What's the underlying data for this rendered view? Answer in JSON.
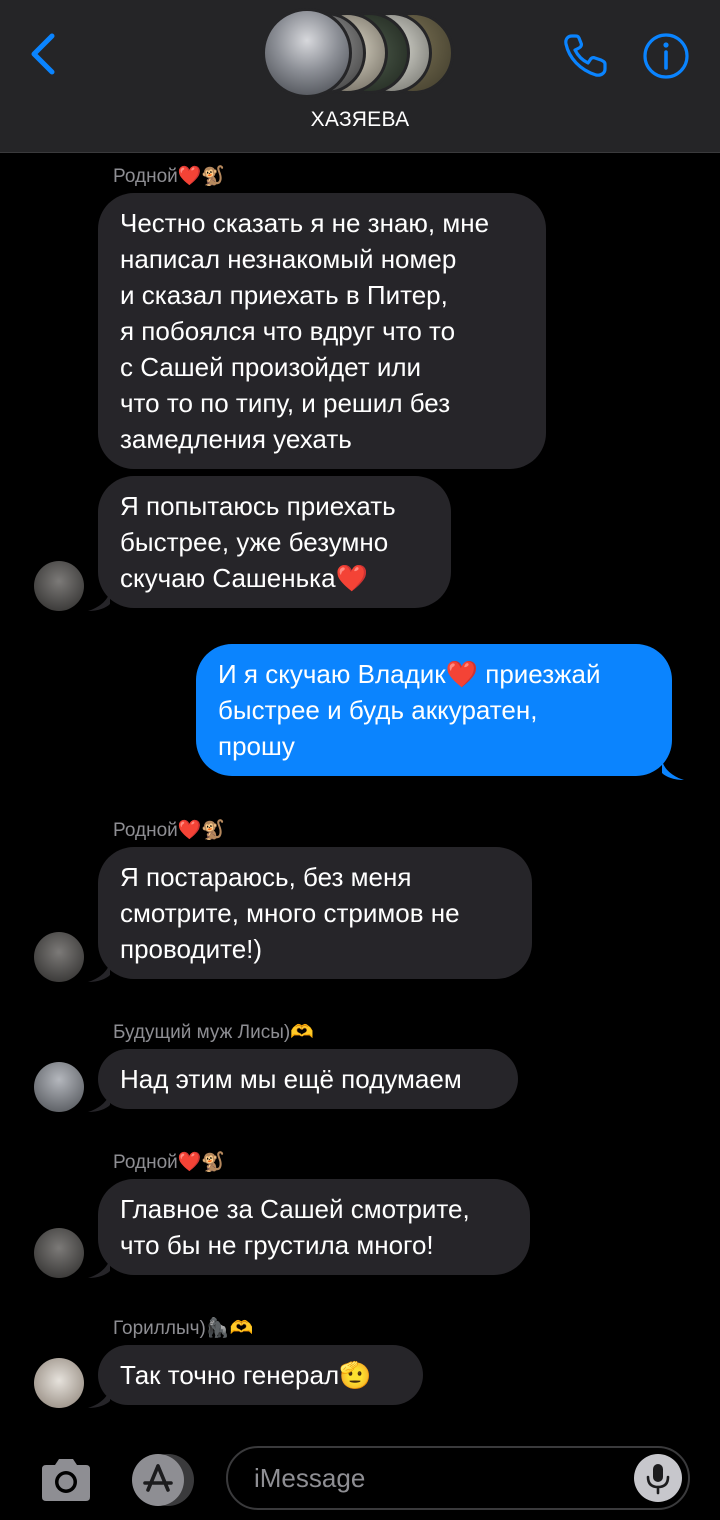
{
  "header": {
    "title": "ХАЗЯЕВА",
    "back_icon": "chevron-left-icon",
    "call_icon": "phone-icon",
    "info_icon": "info-icon",
    "accent_color": "#0a84ff"
  },
  "messages": [
    {
      "sender": "Родной❤️🐒",
      "text": "Честно сказать я не знаю, мне\nнаписал незнакомый номер\nи сказал приехать в Питер,\nя побоялся что вдруг что то\nс Сашей произойдет или\nчто то по типу, и решил без\nзамедления уехать"
    },
    {
      "text": "Я попытаюсь приехать\nбыстрее, уже безумно\nскучаю Сашенька❤️"
    },
    {
      "outgoing": true,
      "text": "И я скучаю Владик❤️ приезжай\nбыстрее и будь аккуратен,\nпрошу"
    },
    {
      "sender": "Родной❤️🐒",
      "text": "Я постараюсь, без меня\nсмотрите, много стримов не\nпроводите!)"
    },
    {
      "sender": "Будущий муж Лисы)🫶",
      "text": "Над этим мы ещё подумаем"
    },
    {
      "sender": "Родной❤️🐒",
      "text": "Главное за Сашей смотрите,\nчто бы не грустила много!"
    },
    {
      "sender": "Гориллыч)🦍🫶",
      "text": "Так точно генерал🫡"
    }
  ],
  "input": {
    "placeholder": "iMessage",
    "camera_icon": "camera-icon",
    "apps_icon": "app-store-icon",
    "mic_icon": "microphone-icon"
  },
  "colors": {
    "incoming_bubble": "#262529",
    "outgoing_bubble": "#0b84fe",
    "sender_label": "#8e8e93",
    "header_bg": "#252527"
  }
}
